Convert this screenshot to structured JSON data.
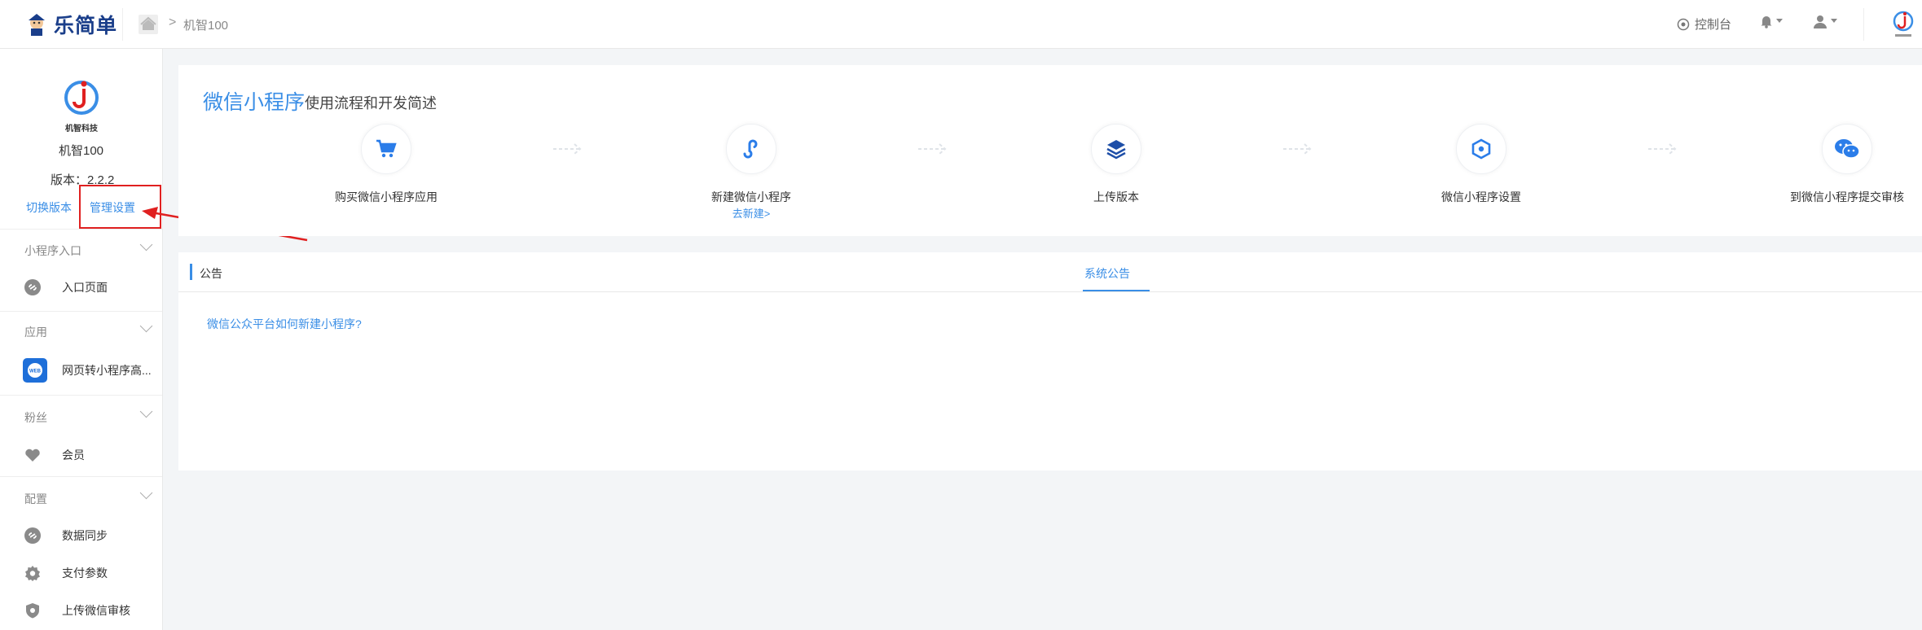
{
  "header": {
    "logo_text": "乐简单",
    "breadcrumb": "机智100",
    "console_label": "控制台"
  },
  "sidebar": {
    "app_name": "机智100",
    "version": "版本：2.2.2",
    "switch_label": "切换版本",
    "manage_label": "管理设置",
    "brand_caption": "机智科技",
    "sections": [
      {
        "title": "小程序入口",
        "items": [
          {
            "label": "入口页面",
            "icon": "link-icon"
          }
        ]
      },
      {
        "title": "应用",
        "items": [
          {
            "label": "网页转小程序高...",
            "icon": "web-icon"
          }
        ]
      },
      {
        "title": "粉丝",
        "items": [
          {
            "label": "会员",
            "icon": "heart-icon"
          }
        ]
      },
      {
        "title": "配置",
        "items": [
          {
            "label": "数据同步",
            "icon": "link-icon"
          },
          {
            "label": "支付参数",
            "icon": "gear-icon"
          },
          {
            "label": "上传微信审核",
            "icon": "shield-icon"
          }
        ]
      }
    ]
  },
  "intro": {
    "title": "微信小程序",
    "subtitle": "使用流程和开发简述",
    "steps": [
      {
        "label": "购买微信小程序应用",
        "icon": "cart-icon"
      },
      {
        "label": "新建微信小程序",
        "link": "去新建>",
        "icon": "miniprogram-icon"
      },
      {
        "label": "上传版本",
        "icon": "layers-icon"
      },
      {
        "label": "微信小程序设置",
        "icon": "hexagon-icon"
      },
      {
        "label": "到微信小程序提交审核",
        "icon": "wechat-icon"
      }
    ]
  },
  "notice": {
    "header": "公告",
    "tab": "系统公告",
    "items": [
      "微信公众平台如何新建小程序?"
    ]
  },
  "colors": {
    "accent": "#3a8ee6",
    "annotation": "#e02020"
  }
}
